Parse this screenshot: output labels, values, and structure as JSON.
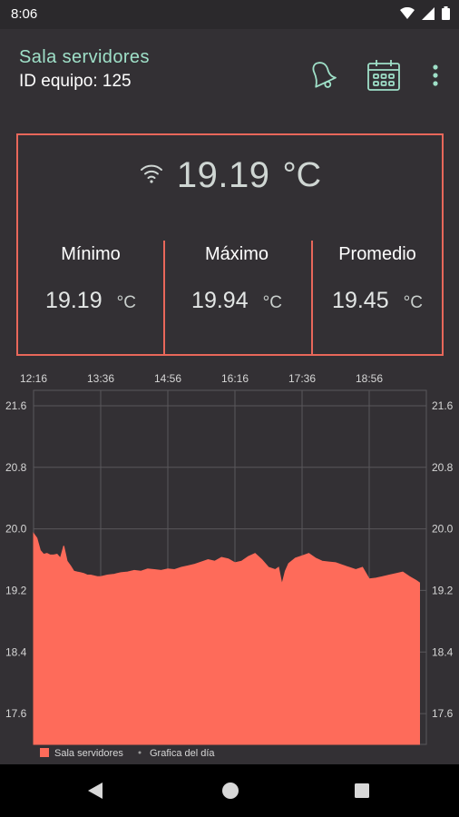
{
  "status_bar": {
    "time": "8:06"
  },
  "header": {
    "title": "Sala servidores",
    "subtitle": "ID equipo: 125",
    "icons": [
      "bell-icon",
      "calendar-icon",
      "more-vert-icon"
    ]
  },
  "current": {
    "value": "19.19",
    "unit": "°C",
    "icon": "wifi-icon"
  },
  "stats": [
    {
      "label": "Mínimo",
      "value": "19.19",
      "unit": "°C"
    },
    {
      "label": "Máximo",
      "value": "19.94",
      "unit": "°C"
    },
    {
      "label": "Promedio",
      "value": "19.45",
      "unit": "°C"
    }
  ],
  "colors": {
    "accent": "#e8675a",
    "area_fill": "#fe6b5a",
    "title_mint": "#9fe0c8",
    "background": "#333034"
  },
  "chart_data": {
    "type": "area",
    "x_ticks": [
      "12:16",
      "13:36",
      "14:56",
      "16:16",
      "17:36",
      "18:56"
    ],
    "y_ticks": [
      21.6,
      20.8,
      20.0,
      19.2,
      18.4,
      17.6
    ],
    "ylim": [
      17.2,
      21.8
    ],
    "grid": true,
    "legend": [
      {
        "label": "Sala servidores",
        "marker": "square"
      },
      {
        "label": "Grafica del día",
        "marker": "dot"
      }
    ],
    "series": [
      {
        "name": "Sala servidores",
        "x": [
          "12:16",
          "12:20",
          "12:24",
          "12:28",
          "12:32",
          "12:36",
          "12:40",
          "12:44",
          "12:48",
          "12:52",
          "12:56",
          "13:00",
          "13:04",
          "13:08",
          "13:12",
          "13:16",
          "13:20",
          "13:24",
          "13:28",
          "13:32",
          "13:36",
          "13:44",
          "13:52",
          "14:00",
          "14:08",
          "14:16",
          "14:24",
          "14:32",
          "14:40",
          "14:48",
          "14:56",
          "15:04",
          "15:12",
          "15:20",
          "15:28",
          "15:36",
          "15:44",
          "15:52",
          "16:00",
          "16:08",
          "16:16",
          "16:24",
          "16:32",
          "16:40",
          "16:48",
          "16:56",
          "17:04",
          "17:08",
          "17:12",
          "17:16",
          "17:20",
          "17:28",
          "17:36",
          "17:44",
          "17:52",
          "18:00",
          "18:08",
          "18:16",
          "18:24",
          "18:32",
          "18:40",
          "18:48",
          "18:56",
          "19:04",
          "19:12",
          "19:20",
          "19:28",
          "19:36",
          "19:44",
          "19:52",
          "19:56"
        ],
        "values": [
          19.94,
          19.88,
          19.72,
          19.67,
          19.68,
          19.66,
          19.66,
          19.67,
          19.62,
          19.78,
          19.58,
          19.52,
          19.45,
          19.44,
          19.43,
          19.42,
          19.4,
          19.4,
          19.39,
          19.38,
          19.38,
          19.4,
          19.41,
          19.43,
          19.44,
          19.46,
          19.45,
          19.48,
          19.47,
          19.46,
          19.48,
          19.47,
          19.5,
          19.52,
          19.54,
          19.57,
          19.6,
          19.58,
          19.63,
          19.61,
          19.56,
          19.58,
          19.64,
          19.68,
          19.6,
          19.5,
          19.47,
          19.5,
          19.28,
          19.45,
          19.55,
          19.62,
          19.65,
          19.68,
          19.62,
          19.58,
          19.57,
          19.56,
          19.53,
          19.5,
          19.47,
          19.5,
          19.35,
          19.36,
          19.38,
          19.4,
          19.42,
          19.44,
          19.38,
          19.33,
          19.3
        ]
      }
    ]
  }
}
